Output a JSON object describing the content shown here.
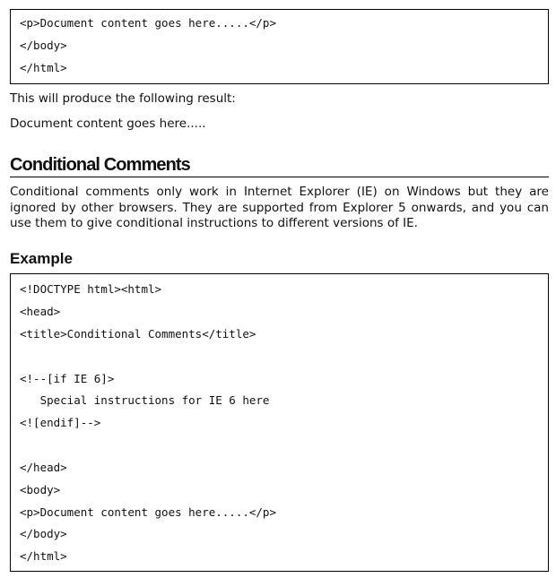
{
  "top_code": {
    "lines": [
      "<p>Document content goes here.....</p>",
      "</body>",
      "</html>"
    ]
  },
  "result_intro": "This will produce the following result:",
  "result_output": "Document content goes here.....",
  "section": {
    "heading": "Conditional Comments",
    "paragraph": "Conditional comments only work in Internet Explorer (IE) on Windows but they are ignored by other browsers. They are supported from Explorer 5 onwards, and you can use them to give conditional instructions to different versions of IE."
  },
  "example": {
    "heading": "Example",
    "lines": [
      "<!DOCTYPE html><html>",
      "<head>",
      "<title>Conditional Comments</title>",
      "",
      "<!--[if IE 6]>",
      "   Special instructions for IE 6 here",
      "<![endif]-->",
      "",
      "</head>",
      "<body>",
      "<p>Document content goes here.....</p>",
      "</body>",
      "</html>"
    ]
  }
}
